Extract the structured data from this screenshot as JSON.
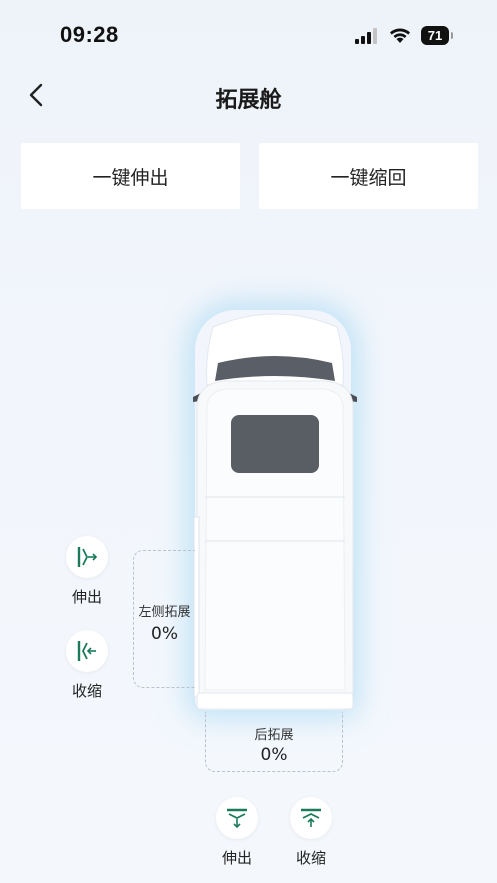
{
  "status_bar": {
    "time": "09:28",
    "battery": "71"
  },
  "header": {
    "title": "拓展舱"
  },
  "actions": {
    "extend_all": "一键伸出",
    "retract_all": "一键缩回"
  },
  "left_expansion": {
    "label": "左侧拓展",
    "value": "0%",
    "extend_label": "伸出",
    "retract_label": "收缩"
  },
  "rear_expansion": {
    "label": "后拓展",
    "value": "0%",
    "extend_label": "伸出",
    "retract_label": "收缩"
  },
  "colors": {
    "accent": "#1b7a5c",
    "background": "#f0f5fb",
    "icon_bg": "#ffffff"
  }
}
